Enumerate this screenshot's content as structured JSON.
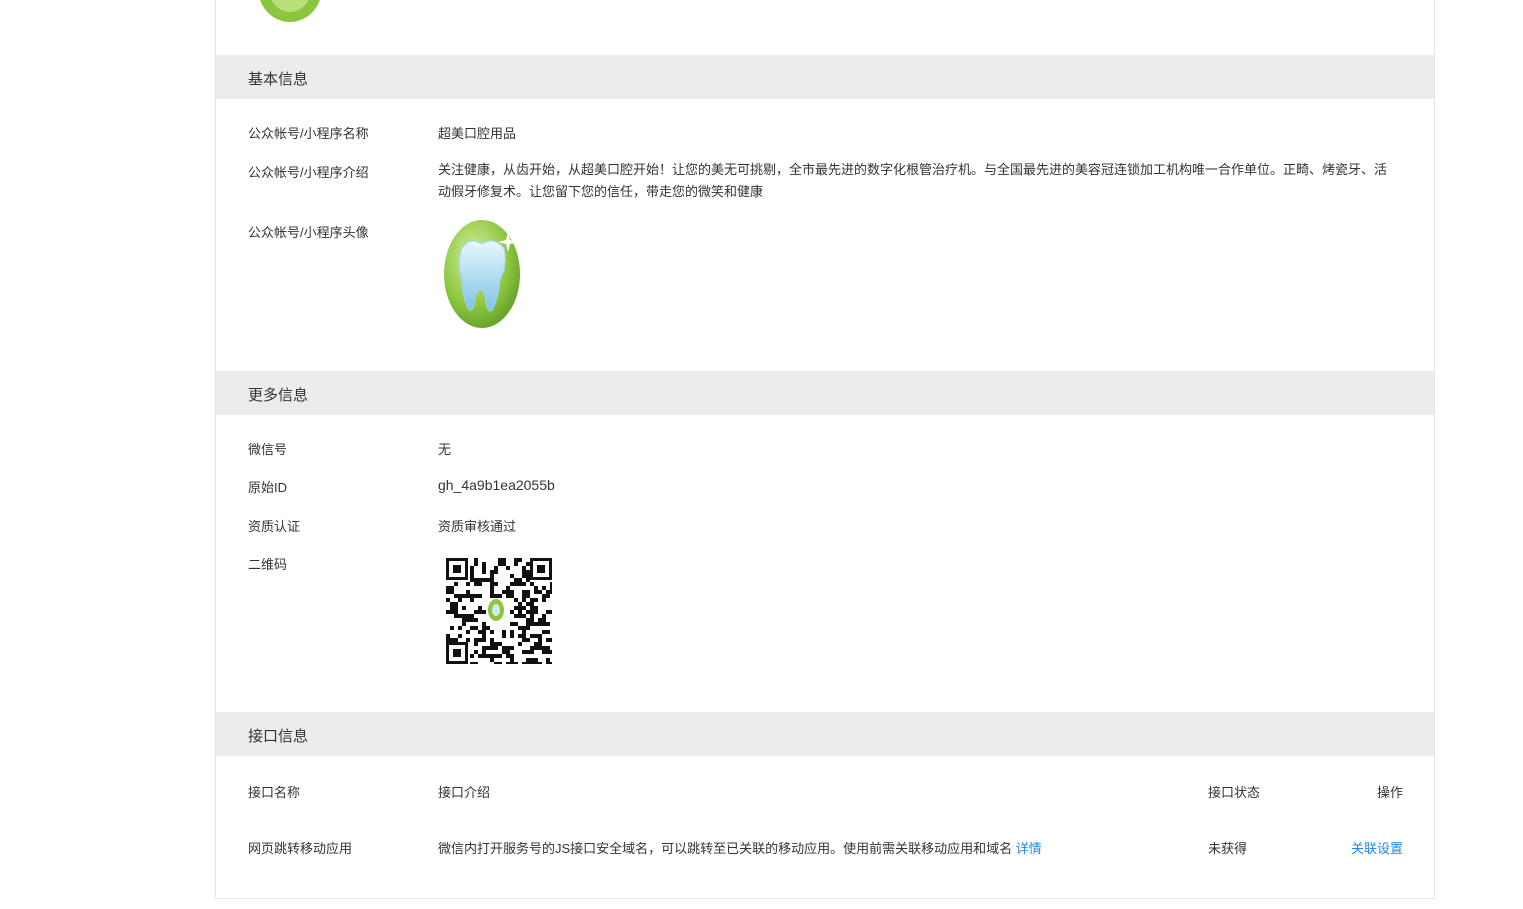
{
  "basic": {
    "header": "基本信息",
    "name_label": "公众帐号/小程序名称",
    "name_value": "超美口腔用品",
    "intro_label": "公众帐号/小程序介绍",
    "intro_value": "关注健康，从齿开始，从超美口腔开始！让您的美无可挑剔，全市最先进的数字化根管治疗机。与全国最先进的美容冠连锁加工机构唯一合作单位。正畸、烤瓷牙、活动假牙修复术。让您留下您的信任，带走您的微笑和健康",
    "avatar_label": "公众帐号/小程序头像"
  },
  "more": {
    "header": "更多信息",
    "wechat_label": "微信号",
    "wechat_value": "无",
    "origin_label": "原始ID",
    "origin_value": "gh_4a9b1ea2055b",
    "qual_label": "资质认证",
    "qual_value": "资质审核通过",
    "qr_label": "二维码"
  },
  "api": {
    "header": "接口信息",
    "columns": [
      "接口名称",
      "接口介绍",
      "接口状态",
      "操作"
    ],
    "rows": [
      {
        "name": "网页跳转移动应用",
        "desc": "微信内打开服务号的JS接口安全域名，可以跳转至已关联的移动应用。使用前需关联移动应用和域名",
        "detail_link": "详情",
        "status": "未获得",
        "action": "关联设置"
      }
    ]
  },
  "colors": {
    "link": "#1e88e5",
    "section_bg": "#ececec",
    "avatar_green": "#8cc63f"
  },
  "icons": [
    "tooth-avatar-icon",
    "qr-code-icon"
  ]
}
